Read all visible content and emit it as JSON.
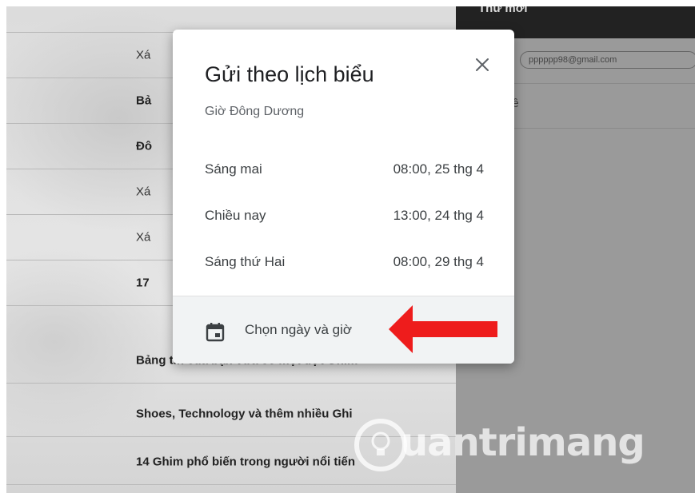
{
  "compose": {
    "header_title": "Thư mới",
    "recipient": "pppppp98@gmail.com",
    "subject_placeholder": "đề"
  },
  "inbox": {
    "rows": [
      {
        "text": "Xá",
        "bold": false
      },
      {
        "text": "Bả",
        "bold": true
      },
      {
        "text": "Đô",
        "bold": true
      },
      {
        "text": "Xá",
        "bold": false
      },
      {
        "text": "Xá",
        "bold": false
      },
      {
        "text": "17",
        "bold": true
      },
      {
        "text": "Bảng tin của bạn vừa có một đợt Ghim",
        "bold": true
      },
      {
        "text": "Shoes, Technology và thêm nhiều Ghi",
        "bold": true
      },
      {
        "text": "14 Ghim phổ biến trong người nổi tiến",
        "bold": true
      }
    ]
  },
  "dialog": {
    "title": "Gửi theo lịch biểu",
    "timezone": "Giờ Đông Dương",
    "options": [
      {
        "label": "Sáng mai",
        "time": "08:00, 25 thg 4"
      },
      {
        "label": "Chiều nay",
        "time": "13:00, 24 thg 4"
      },
      {
        "label": "Sáng thứ Hai",
        "time": "08:00, 29 thg 4"
      }
    ],
    "pick_label": "Chọn ngày và giờ",
    "close_icon": "close-icon",
    "calendar_icon": "calendar-icon"
  },
  "annotation": {
    "arrow_color": "#ee1c1c"
  },
  "watermark": {
    "text": "uantrimang"
  }
}
